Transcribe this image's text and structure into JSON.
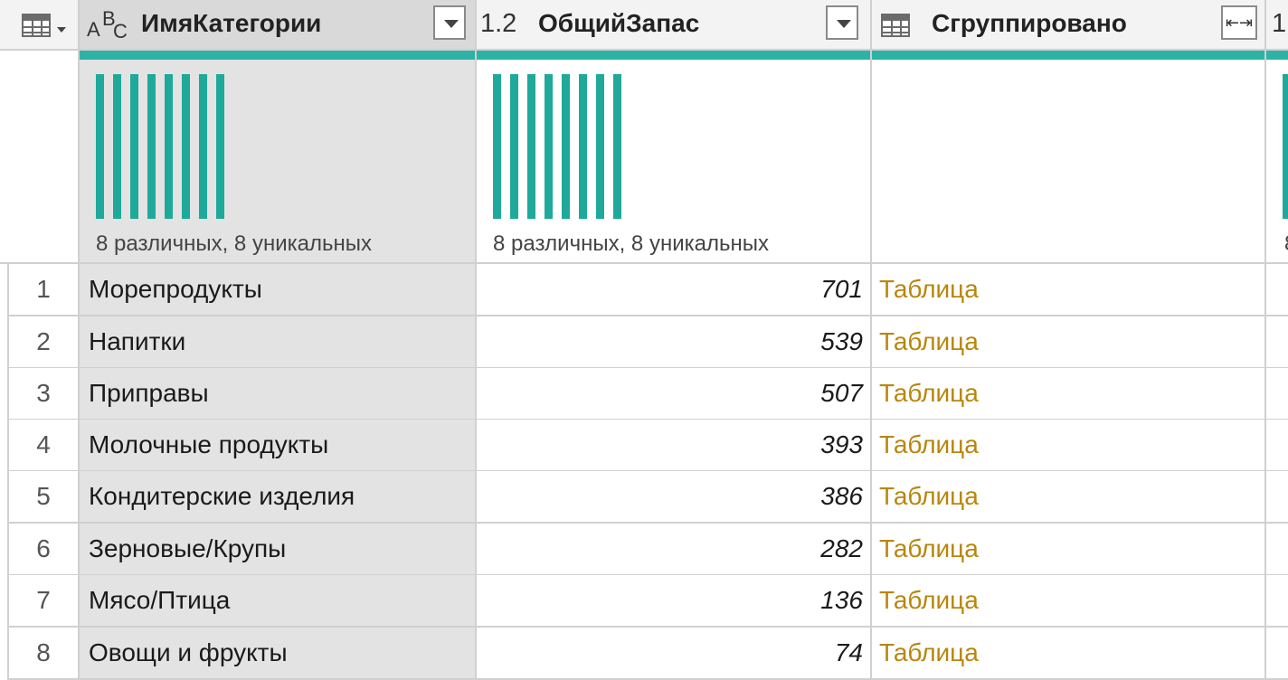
{
  "header": {
    "col1": {
      "type_label_a": "A",
      "type_label_b": "B",
      "type_label_c": "C",
      "title": "ИмяКатегории"
    },
    "col2": {
      "type_label": "1.2",
      "title": "ОбщийЗапас"
    },
    "col3": {
      "title": "Сгруппировано",
      "expand_glyph": "⇤⇥"
    },
    "col4": {
      "type_label": "1"
    }
  },
  "profile": {
    "col1": {
      "summary": "8 различных, 8 уникальных",
      "distinct_bars": 8
    },
    "col2": {
      "summary": "8 различных, 8 уникальных",
      "distinct_bars": 8
    },
    "col4": {
      "summary": "8"
    }
  },
  "rows": [
    {
      "n": "1",
      "category": "Морепродукты",
      "stock": "701",
      "grouped": "Таблица"
    },
    {
      "n": "2",
      "category": "Напитки",
      "stock": "539",
      "grouped": "Таблица"
    },
    {
      "n": "3",
      "category": "Приправы",
      "stock": "507",
      "grouped": "Таблица"
    },
    {
      "n": "4",
      "category": "Молочные продукты",
      "stock": "393",
      "grouped": "Таблица"
    },
    {
      "n": "5",
      "category": "Кондитерские изделия",
      "stock": "386",
      "grouped": "Таблица"
    },
    {
      "n": "6",
      "category": "Зерновые/Крупы",
      "stock": "282",
      "grouped": "Таблица"
    },
    {
      "n": "7",
      "category": "Мясо/Птица",
      "stock": "136",
      "grouped": "Таблица"
    },
    {
      "n": "8",
      "category": "Овощи и фрукты",
      "stock": "74",
      "grouped": "Таблица"
    }
  ],
  "colors": {
    "quality_bar": "#2cb3a5",
    "distinct_bar": "#1fa99b",
    "table_link": "#b8860b",
    "selected_column": "#e3e3e3"
  }
}
